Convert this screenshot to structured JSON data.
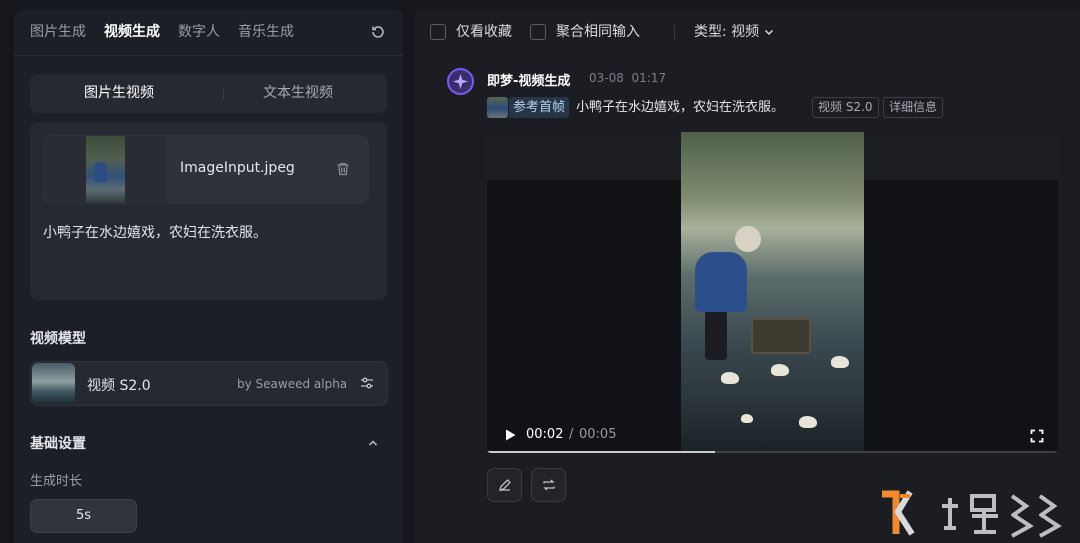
{
  "left": {
    "tabs": [
      {
        "label": "图片生成",
        "active": false
      },
      {
        "label": "视频生成",
        "active": true
      },
      {
        "label": "数字人",
        "active": false
      },
      {
        "label": "音乐生成",
        "active": false
      }
    ],
    "mode_tabs": {
      "image_to_video": "图片生视频",
      "text_to_video": "文本生视频"
    },
    "upload": {
      "file_name": "ImageInput.jpeg"
    },
    "prompt_text": "小鸭子在水边嬉戏，农妇在洗衣服。",
    "model_section_title": "视频模型",
    "model": {
      "name": "视频 S2.0",
      "by": "by Seaweed alpha"
    },
    "basic_settings_title": "基础设置",
    "duration_label": "生成时长",
    "duration_value": "5s"
  },
  "right": {
    "filters": {
      "favorites_only": "仅看收藏",
      "merge_same_input": "聚合相同输入",
      "type_select": "类型: 视频"
    },
    "message": {
      "title": "即梦-视频生成",
      "date": "03-08",
      "time": "01:17",
      "ref_label": "参考首帧",
      "prompt": "小鸭子在水边嬉戏，农妇在洗衣服。",
      "tags": [
        "视频 S2.0",
        "详细信息"
      ]
    },
    "video": {
      "current_time": "00:02",
      "separator": "/",
      "total_time": "00:05",
      "progress": 0.4
    }
  },
  "icons": {
    "refresh": "refresh-icon",
    "trash": "trash-icon",
    "settings": "sliders-icon",
    "chevron_up": "chevron-up-icon",
    "chevron_down": "chevron-down-icon",
    "play": "play-icon",
    "fullscreen": "fullscreen-icon",
    "edit": "pencil-icon",
    "regenerate": "repeat-icon"
  },
  "colors": {
    "accent": "#7a5cf0",
    "panel": "#1d1f26",
    "background": "#16171c"
  }
}
